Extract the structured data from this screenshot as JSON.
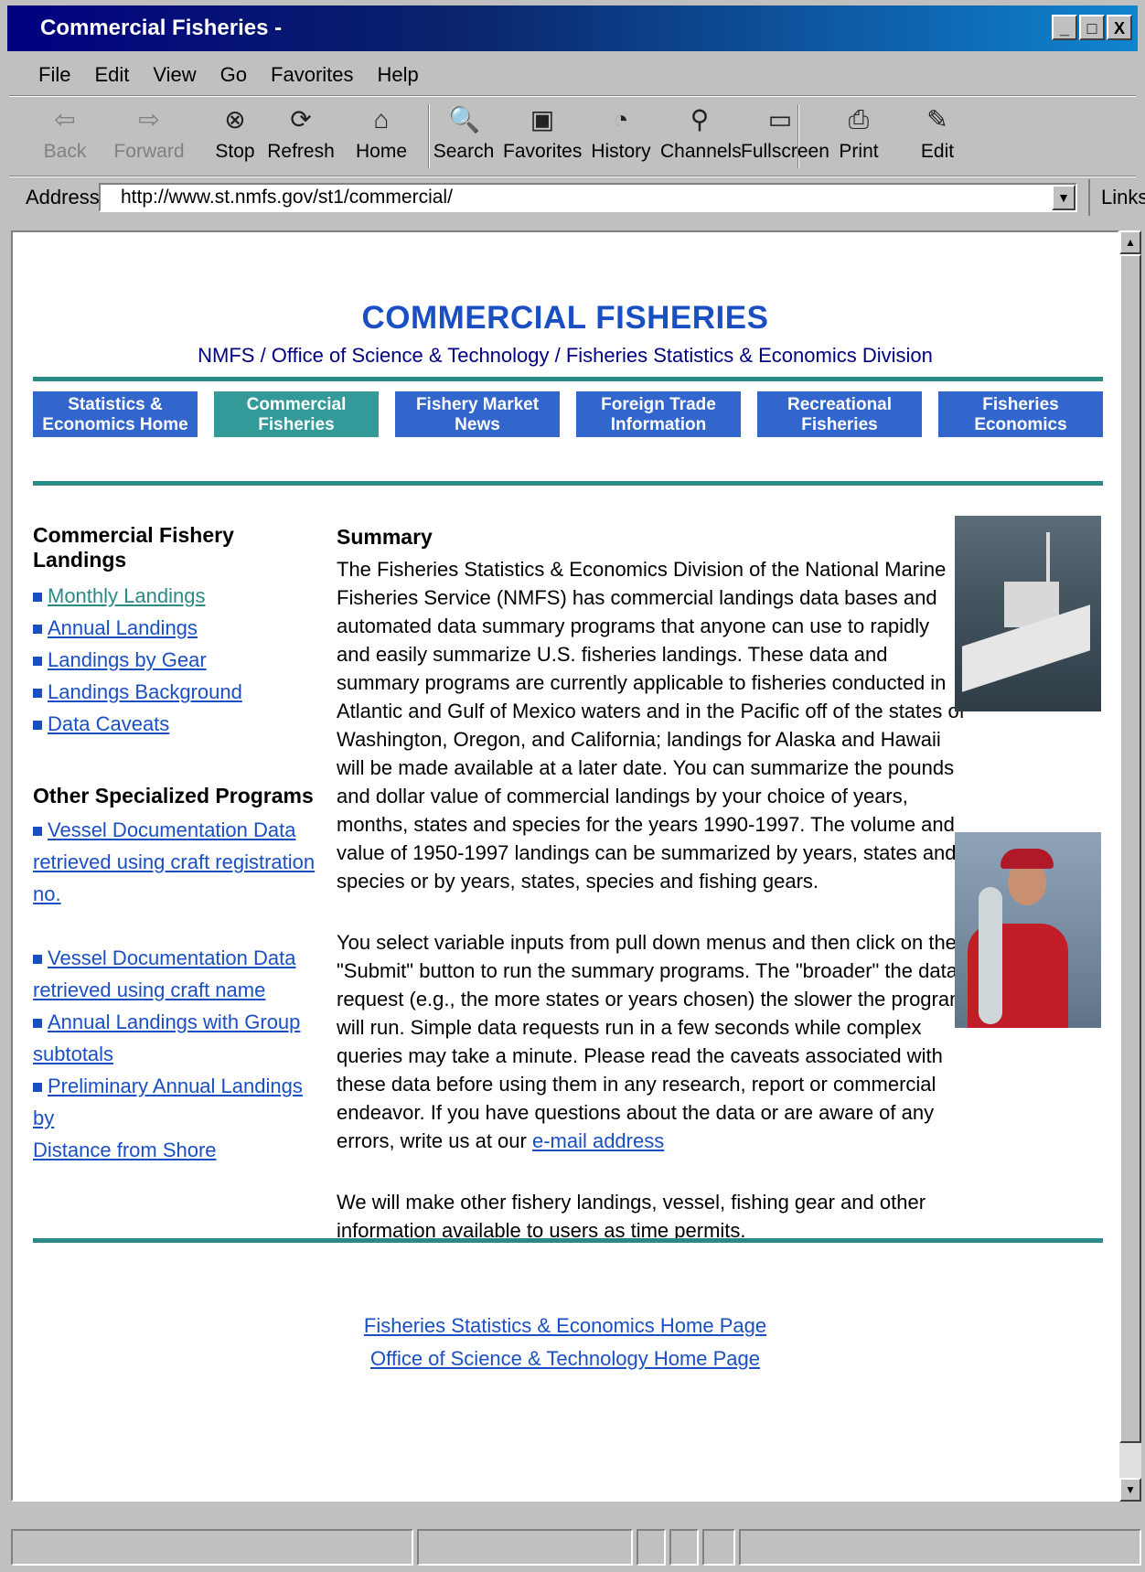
{
  "window": {
    "title": "Commercial Fisheries -",
    "controls": [
      "_",
      "□",
      "X"
    ]
  },
  "menu": [
    "File",
    "Edit",
    "View",
    "Go",
    "Favorites",
    "Help"
  ],
  "toolbar": [
    {
      "label": "Back",
      "icon": "back-arrow-icon",
      "enabled": false
    },
    {
      "label": "Forward",
      "icon": "forward-arrow-icon",
      "enabled": false
    },
    {
      "label": "Stop",
      "icon": "stop-icon",
      "enabled": true
    },
    {
      "label": "Refresh",
      "icon": "refresh-icon",
      "enabled": true
    },
    {
      "label": "Home",
      "icon": "home-icon",
      "enabled": true
    },
    {
      "label": "Search",
      "icon": "search-icon",
      "enabled": true
    },
    {
      "label": "Favorites",
      "icon": "favorites-icon",
      "enabled": true
    },
    {
      "label": "History",
      "icon": "history-icon",
      "enabled": true
    },
    {
      "label": "Channels",
      "icon": "channels-icon",
      "enabled": true
    },
    {
      "label": "Fullscreen",
      "icon": "fullscreen-icon",
      "enabled": true
    },
    {
      "label": "Print",
      "icon": "print-icon",
      "enabled": true
    },
    {
      "label": "Edit",
      "icon": "edit-icon",
      "enabled": true
    }
  ],
  "address": {
    "label": "Address",
    "url": "http://www.st.nmfs.gov/st1/commercial/",
    "links_label": "Links"
  },
  "page": {
    "title": "COMMERCIAL FISHERIES",
    "subtitle": "NMFS / Office of Science & Technology / Fisheries Statistics & Economics Division",
    "nav": [
      {
        "line1": "Statistics &",
        "line2": "Economics Home",
        "active": false
      },
      {
        "line1": "Commercial",
        "line2": "Fisheries",
        "active": true
      },
      {
        "line1": "Fishery Market",
        "line2": "News",
        "active": false
      },
      {
        "line1": "Foreign Trade",
        "line2": "Information",
        "active": false
      },
      {
        "line1": "Recreational",
        "line2": "Fisheries",
        "active": false
      },
      {
        "line1": "Fisheries",
        "line2": "Economics",
        "active": false
      }
    ],
    "left": {
      "landings_heading": "Commercial Fishery Landings",
      "landings_links": [
        "Monthly Landings",
        "Annual Landings",
        "Landings by Gear",
        "Landings Background",
        "Data Caveats"
      ],
      "programs_heading": "Other Specialized Programs",
      "program1_line1": "Vessel Documentation Data",
      "program1_line2": "retrieved using craft registration no.",
      "program2_line1": "Vessel Documentation Data",
      "program2_line2": "retrieved using craft name",
      "program3_line1": "Annual Landings with Group",
      "program3_line2": "subtotals",
      "program4_line1": "Preliminary Annual Landings by",
      "program4_line2": "Distance from Shore"
    },
    "summary": {
      "heading": "Summary",
      "p1": "The Fisheries Statistics & Economics Division of the National Marine Fisheries Service (NMFS) has commercial landings data bases and automated data summary programs that anyone can use to rapidly and easily summarize U.S. fisheries landings. These data and summary programs are currently applicable to fisheries conducted in Atlantic and Gulf of Mexico waters and in the Pacific off of the states of Washington, Oregon, and California; landings for Alaska and Hawaii will be made available at a later date. You can summarize the pounds and dollar value of commercial landings by your choice of years, months, states and species for the years 1990-1997. The volume and value of 1950-1997 landings can be summarized by years, states and species or by years, states, species and fishing gears.",
      "p2_text": "You select variable inputs from pull down menus and then click on the \"Submit\" button to run the summary programs. The \"broader\" the data request (e.g., the more states or years chosen) the slower the program will run. Simple data requests run in a few seconds while complex queries may take a minute. Please read the caveats associated with these data before using them in any research, report or commercial endeavor. If you have questions about the data or are aware of any errors, write us at our ",
      "p2_link": "e-mail address",
      "p3": "We will make other fishery landings, vessel, fishing gear and other information available to users as time permits."
    },
    "footer_links": [
      "Fisheries Statistics & Economics Home Page",
      "Office of Science & Technology Home Page"
    ]
  }
}
